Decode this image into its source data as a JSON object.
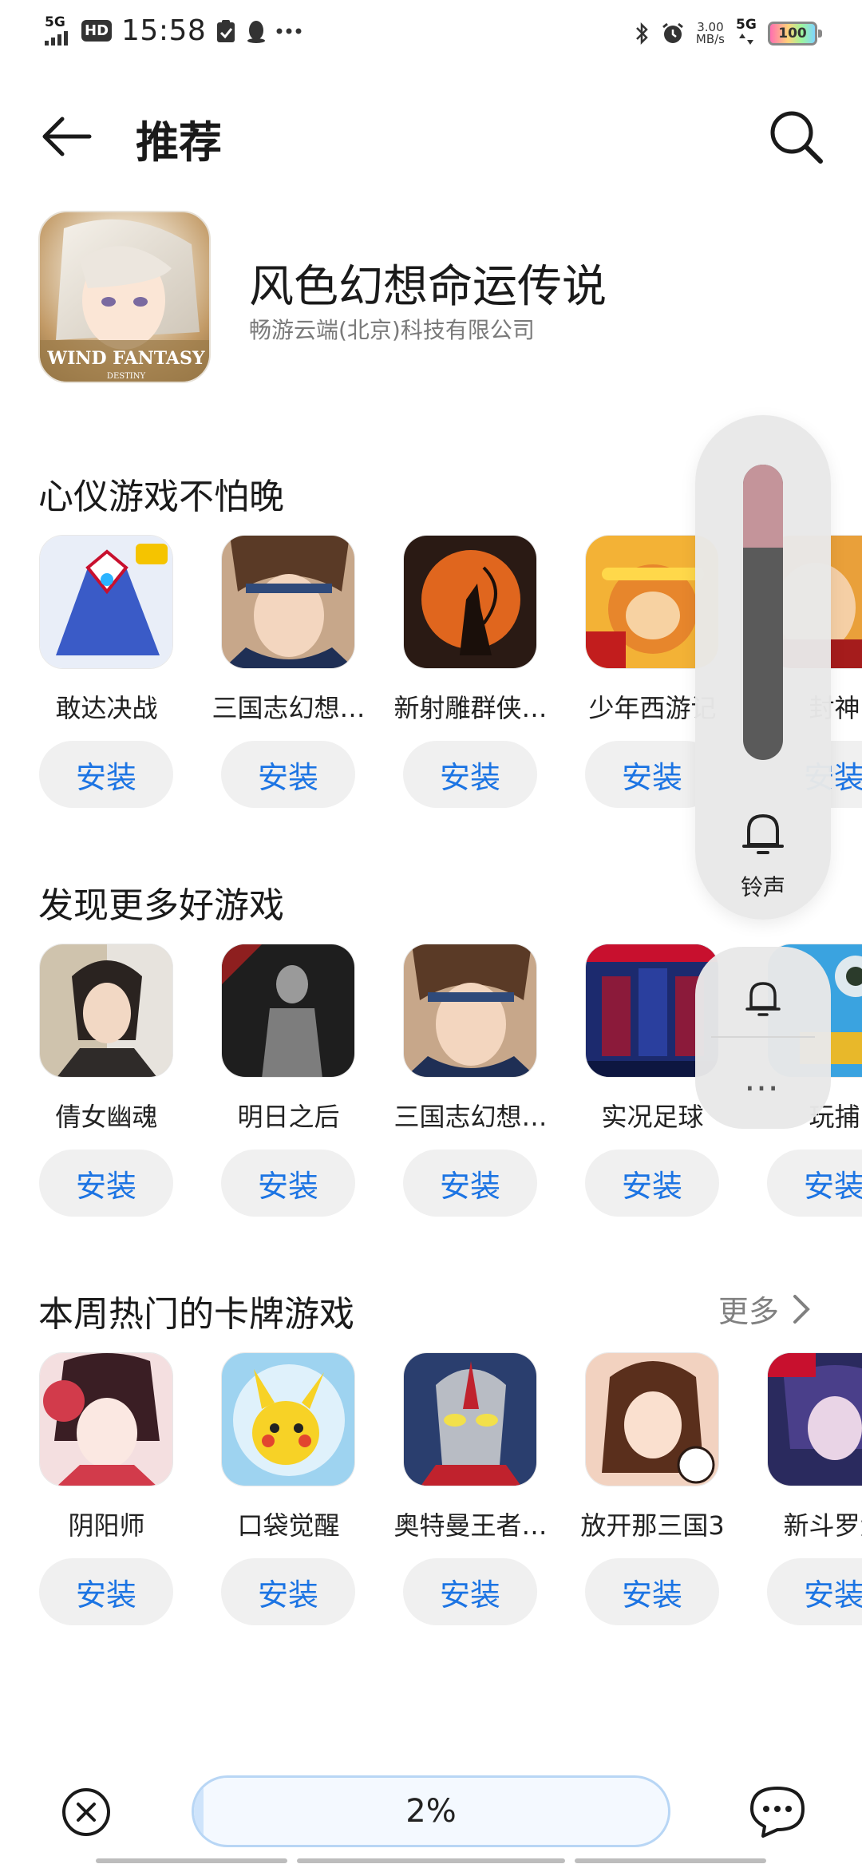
{
  "status_bar": {
    "network": "5G",
    "hd": "HD",
    "time": "15:58",
    "speed_value": "3.00",
    "speed_unit": "MB/s",
    "network_right": "5G",
    "battery": "100"
  },
  "header": {
    "title": "推荐"
  },
  "featured": {
    "name": "风色幻想命运传说",
    "developer": "畅游云端(北京)科技有限公司"
  },
  "sections": [
    {
      "title": "心仪游戏不怕晚",
      "apps": [
        {
          "name": "敢达决战",
          "button": "安装"
        },
        {
          "name": "三国志幻想…",
          "button": "安装"
        },
        {
          "name": "新射雕群侠…",
          "button": "安装"
        },
        {
          "name": "少年西游记",
          "button": "安装"
        },
        {
          "name": "封神",
          "button": "安装"
        }
      ]
    },
    {
      "title": "发现更多好游戏",
      "apps": [
        {
          "name": "倩女幽魂",
          "button": "安装"
        },
        {
          "name": "明日之后",
          "button": "安装"
        },
        {
          "name": "三国志幻想…",
          "button": "安装"
        },
        {
          "name": "实况足球",
          "button": "安装"
        },
        {
          "name": "玩捕",
          "button": "安装"
        }
      ]
    },
    {
      "title": "本周热门的卡牌游戏",
      "more": "更多",
      "apps": [
        {
          "name": "阴阳师",
          "button": "安装"
        },
        {
          "name": "口袋觉醒",
          "button": "安装"
        },
        {
          "name": "奥特曼王者…",
          "button": "安装"
        },
        {
          "name": "放开那三国3",
          "button": "安装"
        },
        {
          "name": "新斗罗大",
          "button": "安装"
        }
      ]
    }
  ],
  "volume_overlay": {
    "label": "铃声",
    "level": 0.28,
    "more": "…"
  },
  "bottom_bar": {
    "progress_text": "2%",
    "progress": 0.02
  },
  "colors": {
    "accent": "#1c74e3",
    "install_bg": "#f0f0f0",
    "volume_fill": "#c4949a",
    "volume_track": "#5a5a5a"
  }
}
